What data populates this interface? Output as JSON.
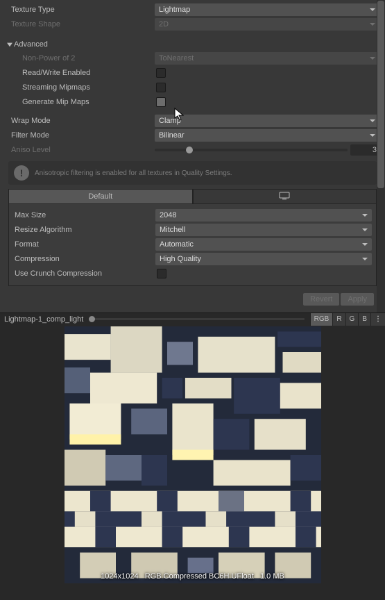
{
  "textureType": {
    "label": "Texture Type",
    "value": "Lightmap"
  },
  "textureShape": {
    "label": "Texture Shape",
    "value": "2D"
  },
  "advanced": {
    "header": "Advanced",
    "nonPowerOf2": {
      "label": "Non-Power of 2",
      "value": "ToNearest"
    },
    "readWrite": {
      "label": "Read/Write Enabled"
    },
    "streamingMipmaps": {
      "label": "Streaming Mipmaps"
    },
    "generateMipMaps": {
      "label": "Generate Mip Maps"
    }
  },
  "wrapMode": {
    "label": "Wrap Mode",
    "value": "Clamp"
  },
  "filterMode": {
    "label": "Filter Mode",
    "value": "Bilinear"
  },
  "anisoLevel": {
    "label": "Aniso Level",
    "value": "3",
    "percent": 18
  },
  "info": "Anisotropic filtering is enabled for all textures in Quality Settings.",
  "platform": {
    "default": "Default",
    "maxSize": {
      "label": "Max Size",
      "value": "2048"
    },
    "resizeAlgo": {
      "label": "Resize Algorithm",
      "value": "Mitchell"
    },
    "format": {
      "label": "Format",
      "value": "Automatic"
    },
    "compression": {
      "label": "Compression",
      "value": "High Quality"
    },
    "useCrunch": {
      "label": "Use Crunch Compression"
    }
  },
  "buttons": {
    "revert": "Revert",
    "apply": "Apply"
  },
  "preview": {
    "name": "Lightmap-1_comp_light",
    "rgb": "RGB",
    "r": "R",
    "g": "G",
    "b": "B",
    "caption": "1024x1024   RGB Compressed BC6H UFloat   1.0 MB"
  }
}
